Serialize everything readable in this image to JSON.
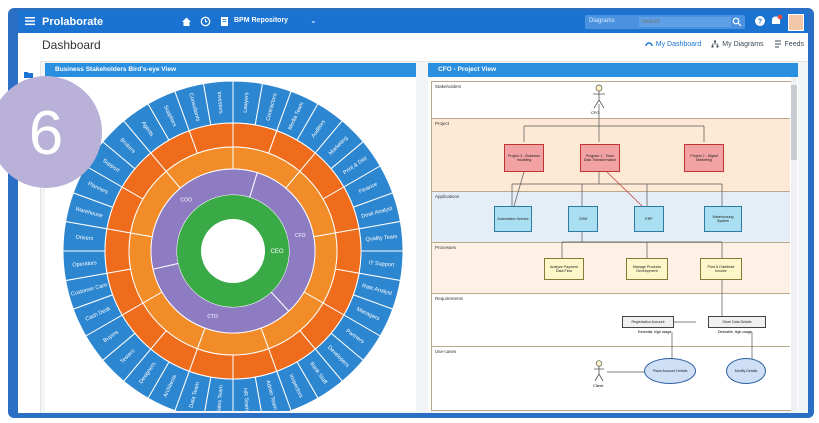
{
  "app": {
    "brand": "Prolaborate",
    "repository": "BPM Repository"
  },
  "topbar": {
    "search_scope": "Diagrams",
    "search_placeholder": "Search",
    "colors": {
      "bar": "#1a73d1",
      "frame": "#2a6fc4"
    }
  },
  "page": {
    "title": "Dashboard"
  },
  "tabs": [
    {
      "label": "My Dashboard",
      "icon": "dashboard-icon",
      "active": true
    },
    {
      "label": "My Diagrams",
      "icon": "diagrams-icon",
      "active": false
    },
    {
      "label": "Feeds",
      "icon": "feeds-icon",
      "active": false
    }
  ],
  "badge": {
    "number": "6"
  },
  "panels": {
    "left": {
      "title": "Business Stakeholders Bird's-eye View",
      "center_label": "CEO"
    },
    "right": {
      "title": "CFO - Project View"
    }
  },
  "diagram": {
    "lanes": [
      "Stakeholders",
      "Project",
      "Applications",
      "Processes",
      "Requirements",
      "Use-cases"
    ],
    "actor_top": "CFO",
    "actor_bottom": "Client",
    "projects": [
      "Project 3 - Business modeling",
      "Program 1 - Team Data Transformation",
      "Project 2 - Digital Marketing"
    ],
    "applications": [
      "Automation Service",
      "CRM",
      "ERP",
      "Warehousing System"
    ],
    "processes": [
      "Analyze Payment Data Flow",
      "Manage Products Development",
      "Print & Distribute Invoice"
    ],
    "requirements": [
      "Registration Account",
      "Store Data Details"
    ],
    "requirement_notes": [
      "Essential, high usage",
      "Desirable, high usage"
    ],
    "usecases": [
      "Place Account Details",
      "Modify Details"
    ]
  },
  "sunburst": {
    "colors": {
      "center": "#3aaa46",
      "ring1": "#8e7cc3",
      "ring2": "#f28c28",
      "ring3": "#ee6c1b",
      "ring4": "#2d86d0"
    },
    "ring2_labels": [
      "CFO",
      "CTO",
      "COO"
    ],
    "outer_labels": [
      "Lawyers",
      "Contractors",
      "Media Team",
      "Auditors",
      "Marketing",
      "Print & Dist",
      "Finance",
      "Desk Analyst",
      "Quality Team",
      "IT Support",
      "Rate Analyst",
      "Managers",
      "Partners",
      "Developers",
      "Bank Staff",
      "Inspectors",
      "Admin Team",
      "HR Team",
      "Sales Team",
      "Data Team",
      "Architects",
      "Designers",
      "Testers",
      "Buyers",
      "Cash Desk",
      "Customer Care",
      "Operators",
      "Drivers",
      "Warehouse",
      "Planners",
      "Support",
      "Brokers",
      "Agents",
      "Suppliers",
      "Consultants",
      "Investors"
    ]
  }
}
